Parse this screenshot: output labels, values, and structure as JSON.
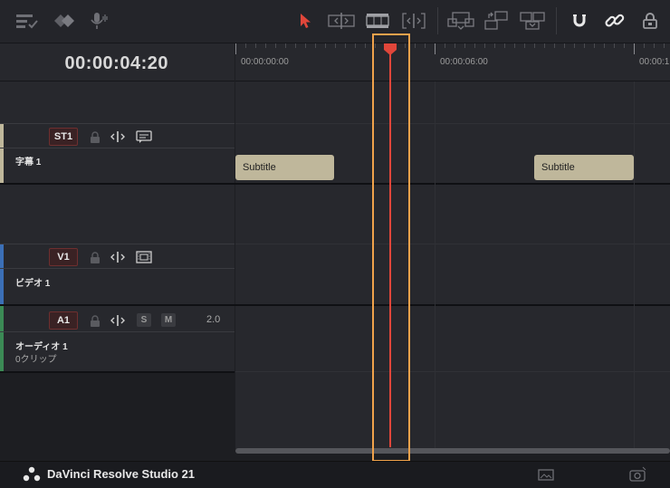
{
  "toolbar": {
    "left_icons": [
      "timeline-options-icon",
      "edit-mode-icon",
      "voiceover-icon"
    ],
    "center_icons": [
      "selection-pointer-icon",
      "trim-edit-icon",
      "blade-icon",
      "dynamic-trim-icon"
    ],
    "edit_icons": [
      "insert-clip-icon",
      "overwrite-clip-icon",
      "replace-clip-icon"
    ],
    "right_icons": [
      "snapping-icon",
      "linked-selection-icon",
      "position-lock-icon"
    ],
    "accent_color": "#e0463a"
  },
  "header": {
    "timecode": "00:00:04:20"
  },
  "ruler": {
    "labels": [
      "00:00:00:00",
      "00:00:06:00",
      "00:00:1"
    ]
  },
  "tracks": {
    "subtitle": {
      "badge": "ST1",
      "name": "字幕 1",
      "color": "#bfb79b"
    },
    "video": {
      "badge": "V1",
      "name": "ビデオ 1",
      "color": "#3b6fb6"
    },
    "audio": {
      "badge": "A1",
      "name": "オーディオ 1",
      "clips": "0クリップ",
      "solo": "S",
      "mute": "M",
      "channels": "2.0",
      "color": "#3b8a55"
    }
  },
  "clips": [
    {
      "label": "Subtitle"
    },
    {
      "label": "Subtitle"
    }
  ],
  "playhead": {
    "color": "#e0463a",
    "highlight_color": "#f0a24b"
  },
  "footer": {
    "app_name": "DaVinci Resolve Studio 21"
  }
}
